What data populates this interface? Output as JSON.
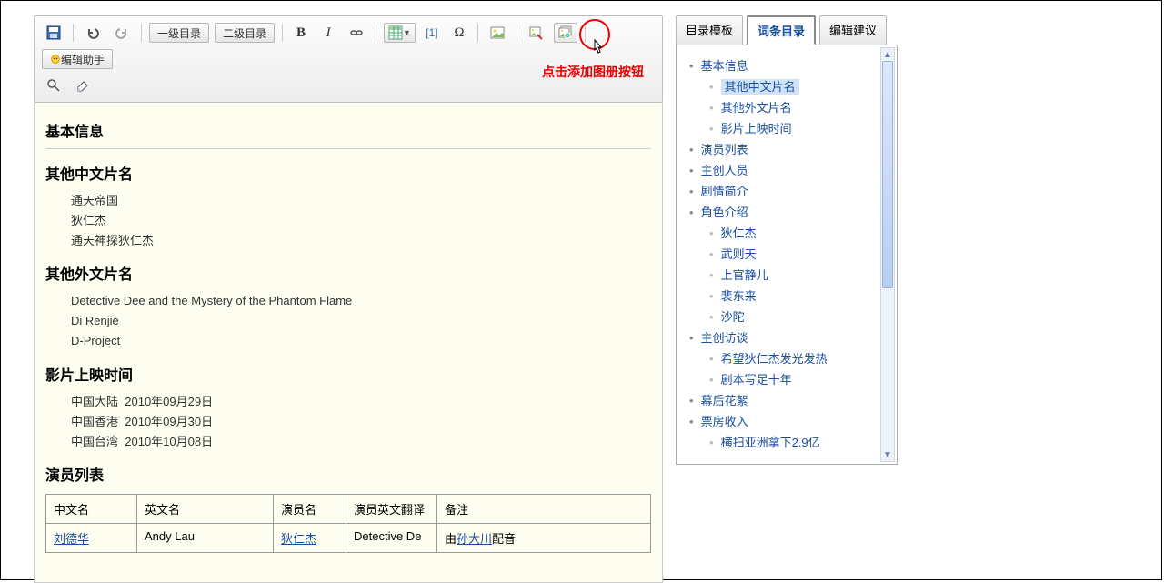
{
  "toolbar": {
    "heading1": "一级目录",
    "heading2": "二级目录",
    "ref": "[1]",
    "omega": "Ω",
    "assistant": "编辑助手"
  },
  "callout": {
    "text": "点击添加图册按钮"
  },
  "content": {
    "h_basic": "基本信息",
    "h_cn_alt": "其他中文片名",
    "cn_alt": [
      "通天帝国",
      "狄仁杰",
      "通天神探狄仁杰"
    ],
    "h_en_alt": "其他外文片名",
    "en_alt": [
      "Detective Dee and the Mystery of the Phantom Flame",
      "Di Renjie",
      "D-Project"
    ],
    "h_release": "影片上映时间",
    "releases": [
      {
        "region": "中国大陆",
        "date": "2010年09月29日"
      },
      {
        "region": "中国香港",
        "date": "2010年09月30日"
      },
      {
        "region": "中国台湾",
        "date": "2010年10月08日"
      }
    ],
    "h_cast": "演员列表",
    "cast_headers": {
      "cn": "中文名",
      "en": "英文名",
      "actor": "演员名",
      "actor_en": "演员英文翻译",
      "note": "备注"
    },
    "cast_row": {
      "cn": "刘德华",
      "en": "Andy Lau",
      "actor": "狄仁杰",
      "actor_en": "Detective De",
      "note_pre": "由",
      "note_link": "孙大川",
      "note_post": "配音"
    }
  },
  "side": {
    "tabs": {
      "template": "目录模板",
      "toc": "词条目录",
      "suggest": "编辑建议"
    },
    "toc": [
      {
        "lvl": 1,
        "label": "基本信息"
      },
      {
        "lvl": 2,
        "label": "其他中文片名",
        "selected": true
      },
      {
        "lvl": 2,
        "label": "其他外文片名"
      },
      {
        "lvl": 2,
        "label": "影片上映时间"
      },
      {
        "lvl": 1,
        "label": "演员列表"
      },
      {
        "lvl": 1,
        "label": "主创人员"
      },
      {
        "lvl": 1,
        "label": "剧情简介"
      },
      {
        "lvl": 1,
        "label": "角色介绍"
      },
      {
        "lvl": 2,
        "label": "狄仁杰"
      },
      {
        "lvl": 2,
        "label": "武则天"
      },
      {
        "lvl": 2,
        "label": "上官静儿"
      },
      {
        "lvl": 2,
        "label": "裴东来"
      },
      {
        "lvl": 2,
        "label": "沙陀"
      },
      {
        "lvl": 1,
        "label": "主创访谈"
      },
      {
        "lvl": 2,
        "label": "希望狄仁杰发光发热"
      },
      {
        "lvl": 2,
        "label": "剧本写足十年"
      },
      {
        "lvl": 1,
        "label": "幕后花絮"
      },
      {
        "lvl": 1,
        "label": "票房收入"
      },
      {
        "lvl": 2,
        "label": "横扫亚洲拿下2.9亿"
      }
    ]
  }
}
